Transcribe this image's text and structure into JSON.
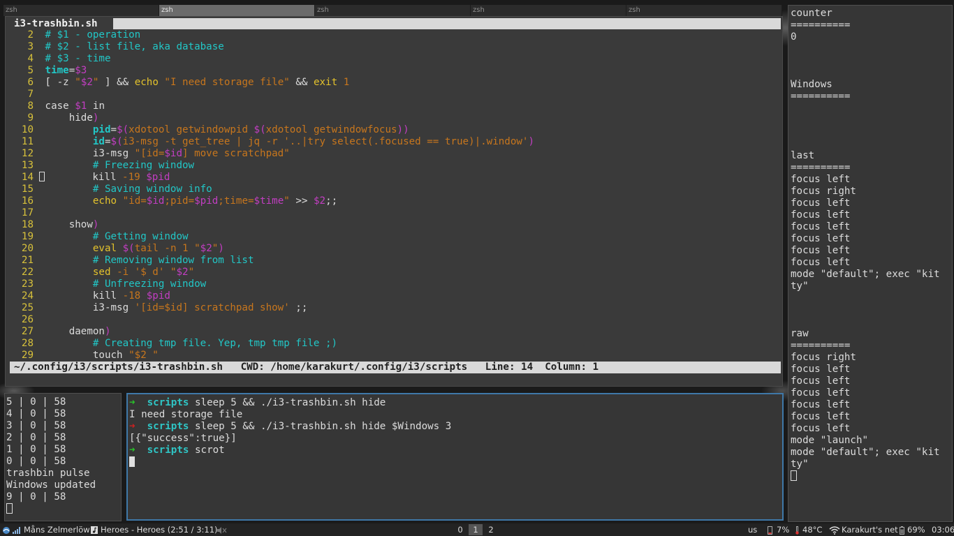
{
  "tabs": [
    "zsh",
    "zsh",
    "zsh",
    "zsh",
    "zsh"
  ],
  "active_tab_index": 1,
  "editor": {
    "filename": "i3-trashbin.sh",
    "status": "~/.config/i3/scripts/i3-trashbin.sh   CWD: /home/karakurt/.config/i3/scripts   Line: 14  Column: 1",
    "lines": [
      {
        "n": "2",
        "t": [
          [
            "cm",
            "# $1 - operation"
          ]
        ]
      },
      {
        "n": "3",
        "t": [
          [
            "cm",
            "# $2 - list file, aka database"
          ]
        ]
      },
      {
        "n": "4",
        "t": [
          [
            "cm",
            "# $3 - time"
          ]
        ]
      },
      {
        "n": "5",
        "t": [
          [
            "vr",
            "time"
          ],
          [
            "pl",
            "="
          ],
          [
            "dl",
            "$3"
          ]
        ]
      },
      {
        "n": "6",
        "t": [
          [
            "pl",
            "[ -z "
          ],
          [
            "st",
            "\""
          ],
          [
            "dl",
            "$2"
          ],
          [
            "st",
            "\""
          ],
          [
            "pl",
            " ] && "
          ],
          [
            "cmd",
            "echo"
          ],
          [
            "pl",
            " "
          ],
          [
            "st",
            "\"I need storage file\""
          ],
          [
            "pl",
            " && "
          ],
          [
            "cmd",
            "exit"
          ],
          [
            "pl",
            " "
          ],
          [
            "st",
            "1"
          ]
        ]
      },
      {
        "n": "7",
        "t": []
      },
      {
        "n": "8",
        "t": [
          [
            "pl",
            "case "
          ],
          [
            "dl",
            "$1"
          ],
          [
            "pl",
            " in"
          ]
        ]
      },
      {
        "n": "9",
        "t": [
          [
            "pl",
            "    hide"
          ],
          [
            "dl",
            ")"
          ]
        ]
      },
      {
        "n": "10",
        "t": [
          [
            "pl",
            "        "
          ],
          [
            "vr",
            "pid"
          ],
          [
            "pl",
            "="
          ],
          [
            "dl",
            "$("
          ],
          [
            "st",
            "xdotool getwindowpid "
          ],
          [
            "dl",
            "$("
          ],
          [
            "st",
            "xdotool getwindowfocus"
          ],
          [
            "dl",
            "))"
          ]
        ]
      },
      {
        "n": "11",
        "t": [
          [
            "pl",
            "        "
          ],
          [
            "vr",
            "id"
          ],
          [
            "pl",
            "="
          ],
          [
            "dl",
            "$("
          ],
          [
            "st",
            "i3-msg -t get_tree | jq -r '..|try select(.focused == true)|.window'"
          ],
          [
            "dl",
            ")"
          ]
        ]
      },
      {
        "n": "12",
        "t": [
          [
            "pl",
            "        i3-msg "
          ],
          [
            "st",
            "\"[id="
          ],
          [
            "dl",
            "$id"
          ],
          [
            "st",
            "] move scratchpad\""
          ]
        ]
      },
      {
        "n": "13",
        "t": [
          [
            "pl",
            "        "
          ],
          [
            "cm",
            "# Freezing window"
          ]
        ]
      },
      {
        "n": "14",
        "cursor": true,
        "t": [
          [
            "pl",
            "        kill "
          ],
          [
            "st",
            "-19 "
          ],
          [
            "dl",
            "$pid"
          ]
        ]
      },
      {
        "n": "15",
        "t": [
          [
            "pl",
            "        "
          ],
          [
            "cm",
            "# Saving window info"
          ]
        ]
      },
      {
        "n": "16",
        "t": [
          [
            "pl",
            "        "
          ],
          [
            "cmd",
            "echo"
          ],
          [
            "pl",
            " "
          ],
          [
            "st",
            "\"id="
          ],
          [
            "dl",
            "$id"
          ],
          [
            "st",
            ";pid="
          ],
          [
            "dl",
            "$pid"
          ],
          [
            "st",
            ";time="
          ],
          [
            "dl",
            "$time"
          ],
          [
            "st",
            "\""
          ],
          [
            "pl",
            " >> "
          ],
          [
            "dl",
            "$2"
          ],
          [
            "pl",
            ";;"
          ]
        ]
      },
      {
        "n": "17",
        "t": []
      },
      {
        "n": "18",
        "t": [
          [
            "pl",
            "    show"
          ],
          [
            "dl",
            ")"
          ]
        ]
      },
      {
        "n": "19",
        "t": [
          [
            "pl",
            "        "
          ],
          [
            "cm",
            "# Getting window"
          ]
        ]
      },
      {
        "n": "20",
        "t": [
          [
            "pl",
            "        "
          ],
          [
            "cmd",
            "eval"
          ],
          [
            "pl",
            " "
          ],
          [
            "dl",
            "$("
          ],
          [
            "st",
            "tail -n 1 "
          ],
          [
            "st",
            "\""
          ],
          [
            "dl",
            "$2"
          ],
          [
            "st",
            "\""
          ],
          [
            "dl",
            ")"
          ]
        ]
      },
      {
        "n": "21",
        "t": [
          [
            "pl",
            "        "
          ],
          [
            "cm",
            "# Removing window from list"
          ]
        ]
      },
      {
        "n": "22",
        "t": [
          [
            "pl",
            "        "
          ],
          [
            "cmd",
            "sed"
          ],
          [
            "pl",
            " "
          ],
          [
            "st",
            "-i '$ d' "
          ],
          [
            "st",
            "\""
          ],
          [
            "dl",
            "$2"
          ],
          [
            "st",
            "\""
          ]
        ]
      },
      {
        "n": "23",
        "t": [
          [
            "pl",
            "        "
          ],
          [
            "cm",
            "# Unfreezing window"
          ]
        ]
      },
      {
        "n": "24",
        "t": [
          [
            "pl",
            "        kill "
          ],
          [
            "st",
            "-18 "
          ],
          [
            "dl",
            "$pid"
          ]
        ]
      },
      {
        "n": "25",
        "t": [
          [
            "pl",
            "        i3-msg "
          ],
          [
            "st",
            "'[id=$id] scratchpad show'"
          ],
          [
            "pl",
            " ;;"
          ]
        ]
      },
      {
        "n": "26",
        "t": []
      },
      {
        "n": "27",
        "t": [
          [
            "pl",
            "    daemon"
          ],
          [
            "dl",
            ")"
          ]
        ]
      },
      {
        "n": "28",
        "t": [
          [
            "pl",
            "        "
          ],
          [
            "cm",
            "# Creating tmp file. Yep, tmp tmp file ;)"
          ]
        ]
      },
      {
        "n": "29",
        "t": [
          [
            "pl",
            "        touch "
          ],
          [
            "st",
            "\"$2 \""
          ]
        ]
      }
    ]
  },
  "right_panel": [
    "counter",
    "==========",
    "0",
    "",
    "",
    "",
    "Windows",
    "==========",
    "",
    "",
    "",
    "",
    "last",
    "==========",
    "focus left",
    "focus right",
    "focus left",
    "focus left",
    "focus left",
    "focus left",
    "focus left",
    "focus left",
    "mode \"default\"; exec \"kit",
    "ty\"",
    "",
    "",
    "",
    "raw",
    "==========",
    "focus right",
    "focus left",
    "focus left",
    "focus left",
    "focus left",
    "focus left",
    "focus left",
    "mode \"launch\"",
    "mode \"default\"; exec \"kit",
    "ty\""
  ],
  "small_terminal": [
    "5 | 0 | 58",
    "4 | 0 | 58",
    "3 | 0 | 58",
    "2 | 0 | 58",
    "1 | 0 | 58",
    "0 | 0 | 58",
    "trashbin pulse",
    "Windows updated",
    "9 | 0 | 58"
  ],
  "terminal": {
    "prompt_arrow": "➜",
    "prompt_dir": "scripts",
    "lines": [
      {
        "type": "prompt",
        "status": "ok",
        "cmd": "sleep 5 && ./i3-trashbin.sh hide"
      },
      {
        "type": "out",
        "text": "I need storage file"
      },
      {
        "type": "prompt",
        "status": "err",
        "cmd": "sleep 5 && ./i3-trashbin.sh hide $Windows 3"
      },
      {
        "type": "out",
        "text": "[{\"success\":true}]"
      },
      {
        "type": "prompt",
        "status": "ok",
        "cmd": "scrot"
      }
    ]
  },
  "statusbar": {
    "player": "Måns Zelmerlöw",
    "track": "Heroes - Heroes (2:51 / 3:11)",
    "workspaces": [
      "0",
      "1",
      "2"
    ],
    "focused_workspace": "1",
    "keyboard": "us",
    "cpu": "7%",
    "temp": "48°C",
    "network": "Karakurt's net",
    "battery": "69%",
    "time": "03:06"
  },
  "colors": {
    "comment": "#22c7c7",
    "string": "#c7761d",
    "dollar": "#c23ec2",
    "command": "#e3c22c",
    "line_number": "#d7c13b",
    "focused_border": "#3f78a8"
  }
}
